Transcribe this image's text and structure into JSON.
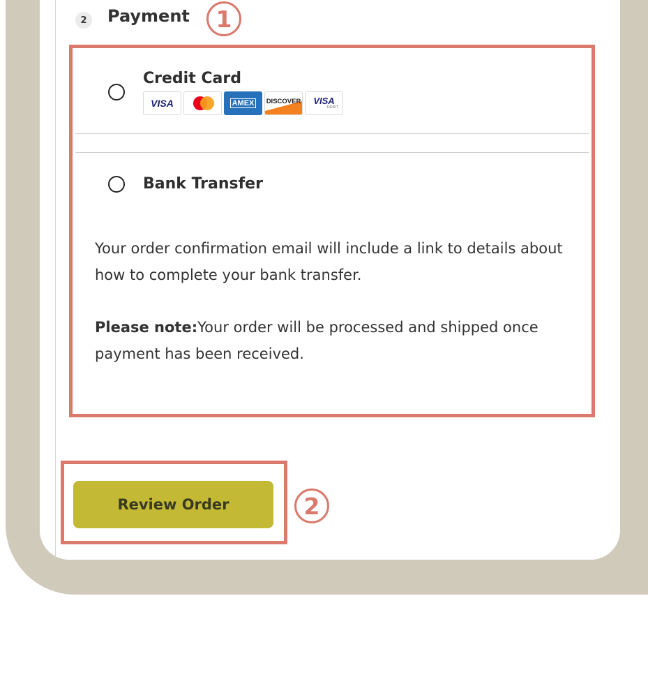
{
  "payment": {
    "step_number": "2",
    "title": "Payment"
  },
  "callouts": {
    "one": "1",
    "two": "2"
  },
  "options": {
    "credit_card": {
      "label": "Credit Card",
      "brands": {
        "visa": "VISA",
        "mastercard": "mastercard-logo",
        "amex": "AMEX",
        "discover": "DISCOVER",
        "visa_debit": "VISA",
        "visa_debit_sub": "DEBIT"
      }
    },
    "bank_transfer": {
      "label": "Bank Transfer",
      "info": "Your order confirmation email will include a link to details about how to complete your bank transfer.",
      "note_label": "Please note:",
      "note_text": "Your order will be processed and shipped once payment has been received."
    }
  },
  "actions": {
    "review_order": "Review Order"
  },
  "colors": {
    "frame": "#d0cabb",
    "highlight": "#d97a6d",
    "button": "#c3b935"
  }
}
